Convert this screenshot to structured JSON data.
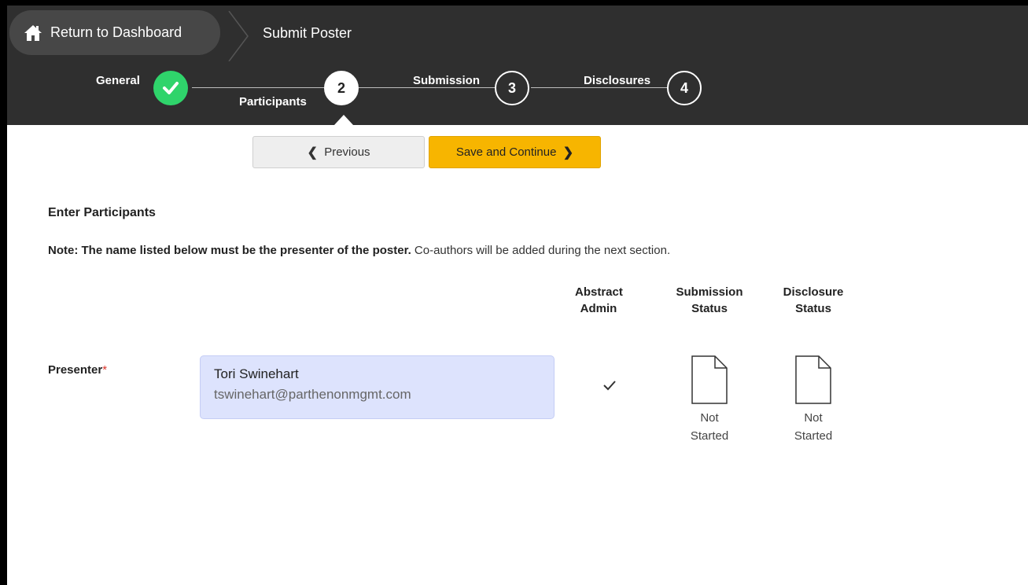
{
  "header": {
    "dashboard_label": "Return to Dashboard",
    "page_title": "Submit Poster"
  },
  "steps": [
    {
      "label": "General",
      "number": "",
      "state": "done"
    },
    {
      "label": "Participants",
      "number": "2",
      "state": "active"
    },
    {
      "label": "Submission",
      "number": "3",
      "state": "todo"
    },
    {
      "label": "Disclosures",
      "number": "4",
      "state": "todo"
    }
  ],
  "actions": {
    "previous_label": "Previous",
    "save_label": "Save and Continue"
  },
  "content": {
    "section_title": "Enter Participants",
    "note_bold": "Note: The name listed below must be the presenter of the poster.",
    "note_rest": " Co-authors will be added during the next section."
  },
  "columns": {
    "abstract_admin_1": "Abstract",
    "abstract_admin_2": "Admin",
    "submission_status_1": "Submission",
    "submission_status_2": "Status",
    "disclosure_status_1": "Disclosure",
    "disclosure_status_2": "Status"
  },
  "presenter": {
    "label": "Presenter",
    "required_marker": "*",
    "name": "Tori Swinehart",
    "email": "tswinehart@parthenonmgmt.com",
    "abstract_admin_checked": true,
    "submission_status_1": "Not",
    "submission_status_2": "Started",
    "disclosure_status_1": "Not",
    "disclosure_status_2": "Started"
  },
  "colors": {
    "topbar": "#2f2f2f",
    "done_step": "#2fd46b",
    "save_button": "#f7b500",
    "presenter_box": "#dde3fd",
    "required": "#d9342b"
  },
  "icons": {
    "dashboard": "home-icon",
    "done_step": "check-icon",
    "previous": "chevron-left-icon",
    "save": "chevron-right-icon",
    "admin": "checkmark-icon",
    "status": "document-icon"
  }
}
